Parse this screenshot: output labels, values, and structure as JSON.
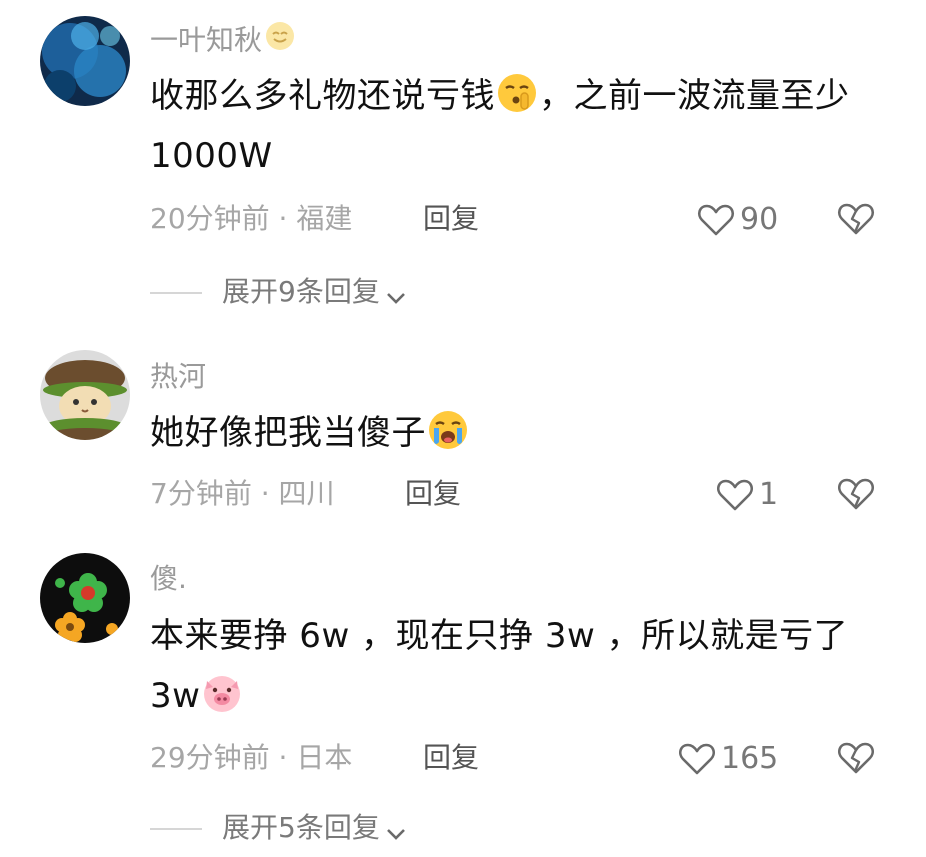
{
  "comments": [
    {
      "username": "一叶知秋",
      "text_before": "收那么多礼物还说亏钱",
      "text_after": "，之前一波流量至少1000W",
      "time": "20分钟前",
      "location": "福建",
      "reply_label": "回复",
      "likes": "90",
      "expand_label": "展开9条回复",
      "icons": {
        "name_emoji": "smile-emoji-icon",
        "inline_emoji": "shush-emoji-icon"
      }
    },
    {
      "username": "热河",
      "text_before": "她好像把我当傻子",
      "time": "7分钟前",
      "location": "四川",
      "reply_label": "回复",
      "likes": "1",
      "icons": {
        "inline_emoji": "crying-emoji-icon"
      }
    },
    {
      "username": "傻.",
      "text_before": "本来要挣 6w ，现在只挣 3w ，所以就是亏了 3w",
      "time": "29分钟前",
      "location": "日本",
      "reply_label": "回复",
      "likes": "165",
      "expand_label": "展开5条回复",
      "icons": {
        "inline_emoji": "pig-emoji-icon"
      }
    }
  ],
  "separator": " · ",
  "colors": {
    "meta": "#a6a6a6",
    "text": "#111111",
    "username": "#9a9a9a"
  }
}
